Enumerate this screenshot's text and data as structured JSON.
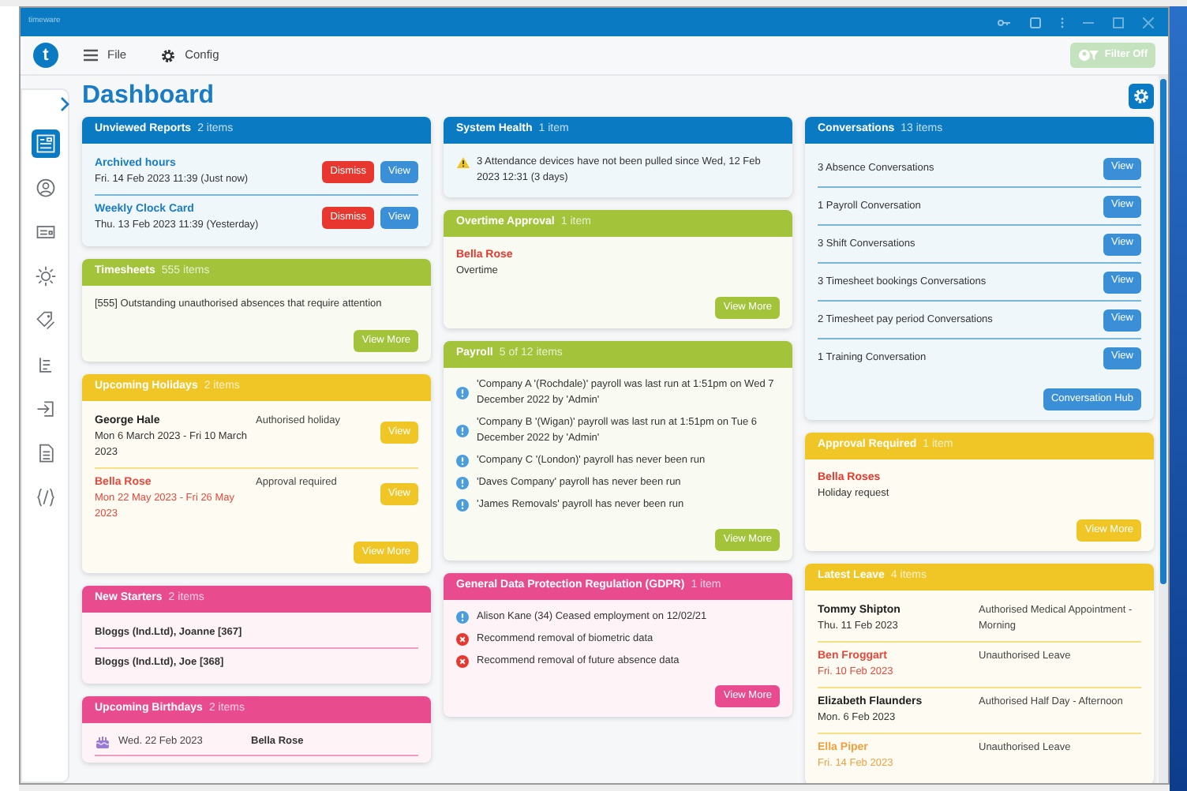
{
  "window": {
    "title": "timeware"
  },
  "toolbar": {
    "logo": "t",
    "menus": [
      {
        "label": "File"
      },
      {
        "label": "Config"
      }
    ],
    "filter_button": {
      "label": "Filter Off",
      "disabled": true
    }
  },
  "sidebar": {
    "items": [
      {
        "selected": true
      },
      {
        "selected": false
      },
      {
        "selected": false
      },
      {
        "selected": false
      },
      {
        "selected": false
      },
      {
        "selected": false
      },
      {
        "selected": false
      },
      {
        "selected": false
      },
      {
        "selected": false
      }
    ]
  },
  "page_title": "Dashboard",
  "columns": [
    [
      {
        "title": "Unviewed Reports",
        "count": "2 items",
        "color": "#0a7bc2",
        "items": [
          {
            "kind": "report",
            "title": "Archived hours",
            "date": "Fri. 14 Feb 2023 11:39 (Just now)",
            "buttons": [
              {
                "label": "Dismiss",
                "kind": "dismiss"
              },
              {
                "label": "View",
                "kind": "view"
              }
            ]
          },
          {
            "kind": "report",
            "title": "Weekly Clock Card",
            "date": "Thu. 13 Feb 2023 11:39 (Yesterday)",
            "buttons": [
              {
                "label": "Dismiss",
                "kind": "dismiss"
              },
              {
                "label": "View",
                "kind": "view"
              }
            ]
          }
        ]
      },
      {
        "title": "Timesheets",
        "count": "555 items",
        "color": "#a2c33a",
        "items": [
          {
            "kind": "text",
            "text": "[555] Outstanding unauthorised absences that require attention"
          }
        ],
        "button": "View More"
      },
      {
        "title": "Upcoming Holidays",
        "count": "2 items",
        "color": "#f0c526",
        "items": [
          {
            "kind": "person",
            "name": "George Hale",
            "date": "Mon 6 March 2023 - Fri 10 March 2023",
            "status": "Authorised holiday",
            "color": "#222222",
            "button": "View"
          },
          {
            "kind": "person",
            "name": "Bella Rose",
            "date": "Mon 22 May 2023 - Fri 26 May 2023",
            "status": "Approval required",
            "color": "#e8473b",
            "button": "View"
          }
        ],
        "button": "View More"
      },
      {
        "title": "New Starters",
        "count": "2 items",
        "color": "#e94b8f",
        "items": [
          {
            "kind": "starter",
            "text": "Bloggs (Ind.Ltd), Joanne [367]"
          },
          {
            "kind": "starter",
            "text": "Bloggs (Ind.Ltd), Joe [368]"
          }
        ]
      },
      {
        "title": "Upcoming Birthdays",
        "count": "2 items",
        "color": "#e94b8f",
        "items": [
          {
            "kind": "birthday",
            "date": "Wed. 22 Feb 2023",
            "name": "Bella Rose"
          }
        ]
      }
    ],
    [
      {
        "title": "System Health",
        "count": "1 item",
        "color": "#0a7bc2",
        "items": [
          {
            "kind": "warning",
            "text": "3 Attendance devices have not been pulled since Wed, 12 Feb 2023 12:31 (3 days)"
          }
        ]
      },
      {
        "title": "Overtime Approval",
        "count": "1 item",
        "color": "#a2c33a",
        "items": [
          {
            "kind": "request",
            "name": "Bella Rose",
            "detail": "Overtime",
            "color": "#e8372e"
          }
        ],
        "button": "View More"
      },
      {
        "title": "Payroll",
        "count": "5 of 12 items",
        "color": "#a2c33a",
        "items": [
          {
            "kind": "info",
            "text": "'Company A '(Rochdale)' payroll was last run at 1:51pm on Wed 7 December 2022 by 'Admin'"
          },
          {
            "kind": "info",
            "text": "'Company B '(Wigan)' payroll was last run at 1:51pm on Tue 6 December 2022 by 'Admin'"
          },
          {
            "kind": "info",
            "text": "'Company C '(London)' payroll has never been run"
          },
          {
            "kind": "info",
            "text": "'Daves Company' payroll has never been run"
          },
          {
            "kind": "info",
            "text": "'James Removals' payroll has never been run"
          }
        ],
        "button": "View More"
      },
      {
        "title": "General Data Protection Regulation (GDPR)",
        "count": "1 item",
        "color": "#e94b8f",
        "items": [
          {
            "kind": "info",
            "text": "Alison Kane (34) Ceased employment on 12/02/21"
          },
          {
            "kind": "error",
            "text": "Recommend removal of biometric data"
          },
          {
            "kind": "error",
            "text": "Recommend removal of future absence data"
          }
        ],
        "button": "View More"
      }
    ],
    [
      {
        "title": "Conversations",
        "count": "13 items",
        "color": "#0a7bc2",
        "items": [
          {
            "kind": "conversation",
            "text": "3 Absence Conversations",
            "button": "View"
          },
          {
            "kind": "conversation",
            "text": "1 Payroll Conversation",
            "button": "View"
          },
          {
            "kind": "conversation",
            "text": "3 Shift Conversations",
            "button": "View"
          },
          {
            "kind": "conversation",
            "text": "3 Timesheet bookings Conversations",
            "button": "View"
          },
          {
            "kind": "conversation",
            "text": "2 Timesheet pay period Conversations",
            "button": "View"
          },
          {
            "kind": "conversation",
            "text": "1 Training Conversation",
            "button": "View"
          }
        ],
        "button": "Conversation Hub"
      },
      {
        "title": "Approval Required",
        "count": "1 item",
        "color": "#f0c526",
        "items": [
          {
            "kind": "request",
            "name": "Bella Roses",
            "detail": "Holiday request",
            "color": "#e8372e"
          }
        ],
        "button": "View More"
      },
      {
        "title": "Latest Leave",
        "count": "4 items",
        "color": "#f0c526",
        "items": [
          {
            "kind": "person",
            "name": "Tommy Shipton",
            "date": "Thu. 11 Feb 2023",
            "status": "Authorised Medical Appointment - Morning",
            "color": "#222222"
          },
          {
            "kind": "person",
            "name": "Ben Froggart",
            "date": "Fri. 10 Feb 2023",
            "status": "Unauthorised Leave",
            "color": "#e8473b"
          },
          {
            "kind": "person",
            "name": "Elizabeth Flaunders",
            "date": "Mon. 6 Feb 2023",
            "status": "Authorised Half Day - Afternoon",
            "color": "#222222"
          },
          {
            "kind": "person",
            "name": "Ella Piper",
            "date": "Fri. 14 Feb 2023",
            "status": "Unauthorised Leave",
            "color": "#f0a040"
          }
        ]
      }
    ]
  ]
}
